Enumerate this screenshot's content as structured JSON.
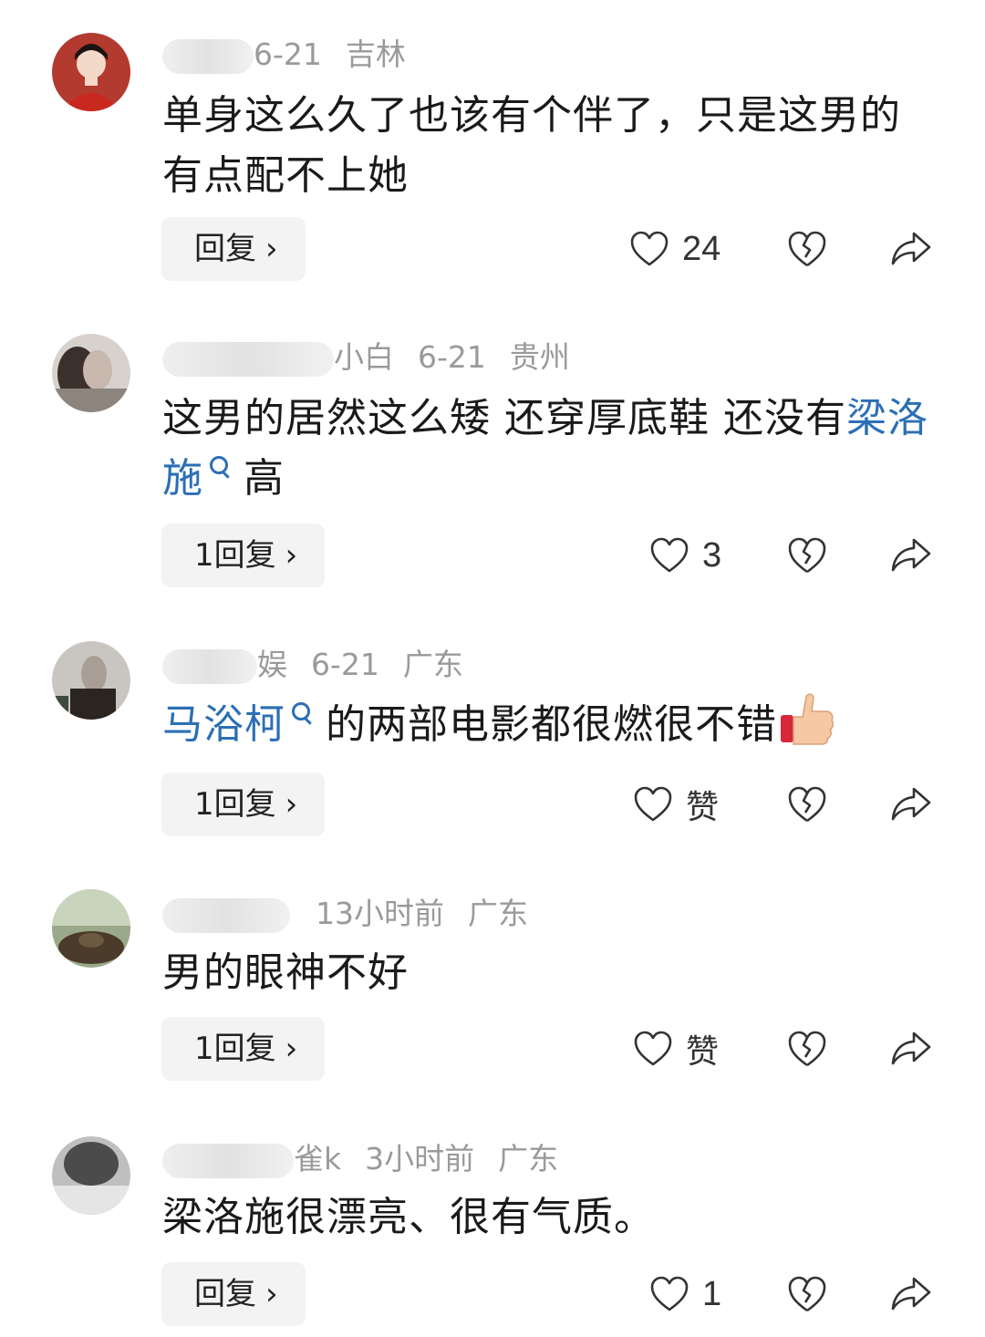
{
  "comments": [
    {
      "name_tail": "6-21",
      "date": "",
      "location": "吉林",
      "text_before": "单身这么久了也该有个伴了，只是这男的有点配不上她",
      "reply_label": "回复",
      "like_count": "24"
    },
    {
      "name_tail": "小白",
      "date": "6-21",
      "location": "贵州",
      "text_before": "这男的居然这么矮 还穿厚底鞋 还没有",
      "link": "梁洛施",
      "text_after": "高",
      "reply_label": "1回复",
      "like_count": "3"
    },
    {
      "name_tail": "娱",
      "date": "6-21",
      "location": "广东",
      "link": "马浴柯",
      "text_after": "的两部电影都很燃很不错",
      "reply_label": "1回复",
      "like_count": "赞"
    },
    {
      "name_tail": "",
      "date": "13小时前",
      "location": "广东",
      "text_before": "男的眼神不好",
      "reply_label": "1回复",
      "like_count": "赞"
    },
    {
      "name_tail": "雀k",
      "date": "3小时前",
      "location": "广东",
      "text_before": "梁洛施很漂亮、很有气质。",
      "reply_label": "回复",
      "like_count": "1"
    }
  ],
  "colors": {
    "link": "#2c6fb5",
    "meta": "#9a9a9a",
    "button_bg": "#f3f3f3"
  },
  "icons": [
    "heart-icon",
    "broken-heart-icon",
    "share-icon",
    "search-icon",
    "thumbs-up-icon"
  ]
}
